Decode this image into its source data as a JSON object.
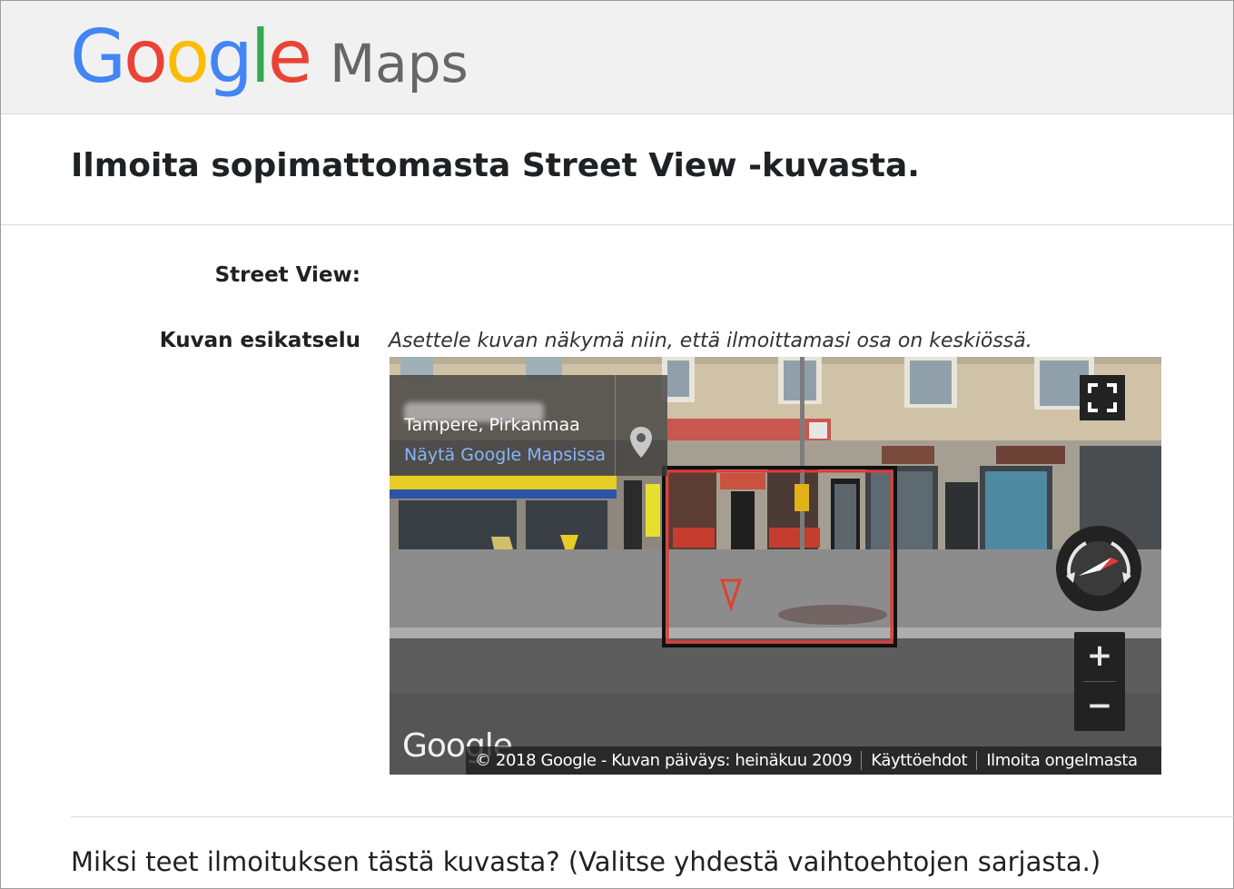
{
  "header": {
    "logo_letters": [
      {
        "char": "G",
        "color": "#4285F4"
      },
      {
        "char": "o",
        "color": "#EA4335"
      },
      {
        "char": "o",
        "color": "#FBBC05"
      },
      {
        "char": "g",
        "color": "#4285F4"
      },
      {
        "char": "l",
        "color": "#34A853"
      },
      {
        "char": "e",
        "color": "#EA4335"
      }
    ],
    "product_name": "Maps"
  },
  "page": {
    "title": "Ilmoita sopimattomasta Street View -kuvasta.",
    "question": "Miksi teet ilmoituksen tästä kuvasta? (Valitse yhdestä vaihtoehtojen sarjasta.)"
  },
  "form": {
    "street_view_label": "Street View:",
    "preview_label": "Kuvan esikatselu",
    "preview_hint": "Asettele kuvan näkymä niin, että ilmoittamasi osa on keskiössä."
  },
  "viewer": {
    "location_city": "Tampere, Pirkanmaa",
    "map_link": "Näytä Google Mapsissa",
    "watermark": "Google",
    "copyright": "© 2018 Google - Kuvan päiväys: heinäkuu 2009",
    "terms_link": "Käyttöehdot",
    "report_link": "Ilmoita ongelmasta",
    "zoom_in": "+",
    "zoom_out": "−",
    "icons": {
      "fullscreen": "fullscreen-icon",
      "pin": "map-pin-icon",
      "compass": "compass-icon"
    },
    "colors": {
      "selection_outline": "#E53935",
      "link": "#8AB4F8"
    }
  }
}
